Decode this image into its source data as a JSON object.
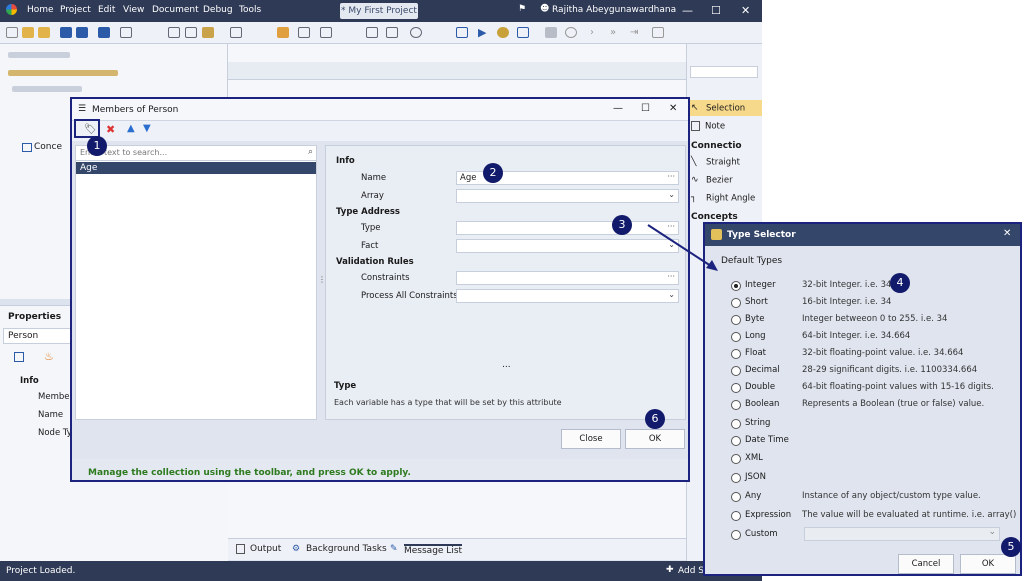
{
  "menubar": {
    "items": [
      "Home",
      "Project",
      "Edit",
      "View",
      "Document",
      "Debug",
      "Tools"
    ],
    "document_title": "* My First Project",
    "user": "Rajitha Abeygunawardhana"
  },
  "tree": {
    "concept_label": "Conce"
  },
  "properties": {
    "title": "Properties",
    "selected": "Person",
    "section": "Info",
    "fields": [
      "Member",
      "Name",
      "Node Ty"
    ]
  },
  "bottom_tabs": [
    "Output",
    "Background Tasks",
    "Message List"
  ],
  "status": "Project Loaded.",
  "status_right": "Add Sc",
  "toolbox": {
    "items_top": [
      "Selection",
      "Note"
    ],
    "section_connection": "Connectio",
    "connection_items": [
      "Straight",
      "Bezier",
      "Right Angle"
    ],
    "section_concepts": "Concepts"
  },
  "members_dialog": {
    "title": "Members of Person",
    "search_placeholder": "Enter text to search...",
    "list": [
      "Age"
    ],
    "sections": {
      "info": "Info",
      "type_address": "Type Address",
      "validation": "Validation Rules"
    },
    "fields": {
      "name_label": "Name",
      "name_value": "Age",
      "array_label": "Array",
      "type_label": "Type",
      "fact_label": "Fact",
      "constraints_label": "Constraints",
      "process_label": "Process All Constraints"
    },
    "ellipsis": "...",
    "desc_title": "Type",
    "desc_text": "Each variable has a type that will be set by this attribute",
    "close_label": "Close",
    "ok_label": "OK",
    "hint": "Manage the collection using the toolbar, and press OK to apply."
  },
  "type_selector": {
    "title": "Type Selector",
    "group": "Default Types",
    "types": [
      {
        "name": "Integer",
        "desc": "32-bit Integer. i.e. 34",
        "selected": true
      },
      {
        "name": "Short",
        "desc": "16-bit Integer. i.e. 34",
        "selected": false
      },
      {
        "name": "Byte",
        "desc": "Integer betweeon 0 to 255. i.e. 34",
        "selected": false
      },
      {
        "name": "Long",
        "desc": "64-bit Integer. i.e. 34.664",
        "selected": false
      },
      {
        "name": "Float",
        "desc": "32-bit floating-point value. i.e. 34.664",
        "selected": false
      },
      {
        "name": "Decimal",
        "desc": "28-29 significant digits. i.e. 1100334.664",
        "selected": false
      },
      {
        "name": "Double",
        "desc": "64-bit floating-point values with 15-16 digits.",
        "selected": false
      },
      {
        "name": "Boolean",
        "desc": "Represents a Boolean (true or false) value.",
        "selected": false
      },
      {
        "name": "String",
        "desc": "",
        "selected": false
      },
      {
        "name": "Date Time",
        "desc": "",
        "selected": false
      },
      {
        "name": "XML",
        "desc": "",
        "selected": false
      },
      {
        "name": "JSON",
        "desc": "",
        "selected": false
      },
      {
        "name": "Any",
        "desc": "Instance of any object/custom type value.",
        "selected": false
      },
      {
        "name": "Expression",
        "desc": "The value will be evaluated at runtime. i.e. array()",
        "selected": false
      },
      {
        "name": "Custom",
        "desc": "",
        "selected": false
      }
    ],
    "cancel_label": "Cancel",
    "ok_label": "OK"
  },
  "callouts": [
    "1",
    "2",
    "3",
    "4",
    "5",
    "6"
  ],
  "colors": {
    "titlebar": "#2e3a56",
    "callout": "#121a6b",
    "hint": "#2d7a1f",
    "selection": "#34466a"
  }
}
